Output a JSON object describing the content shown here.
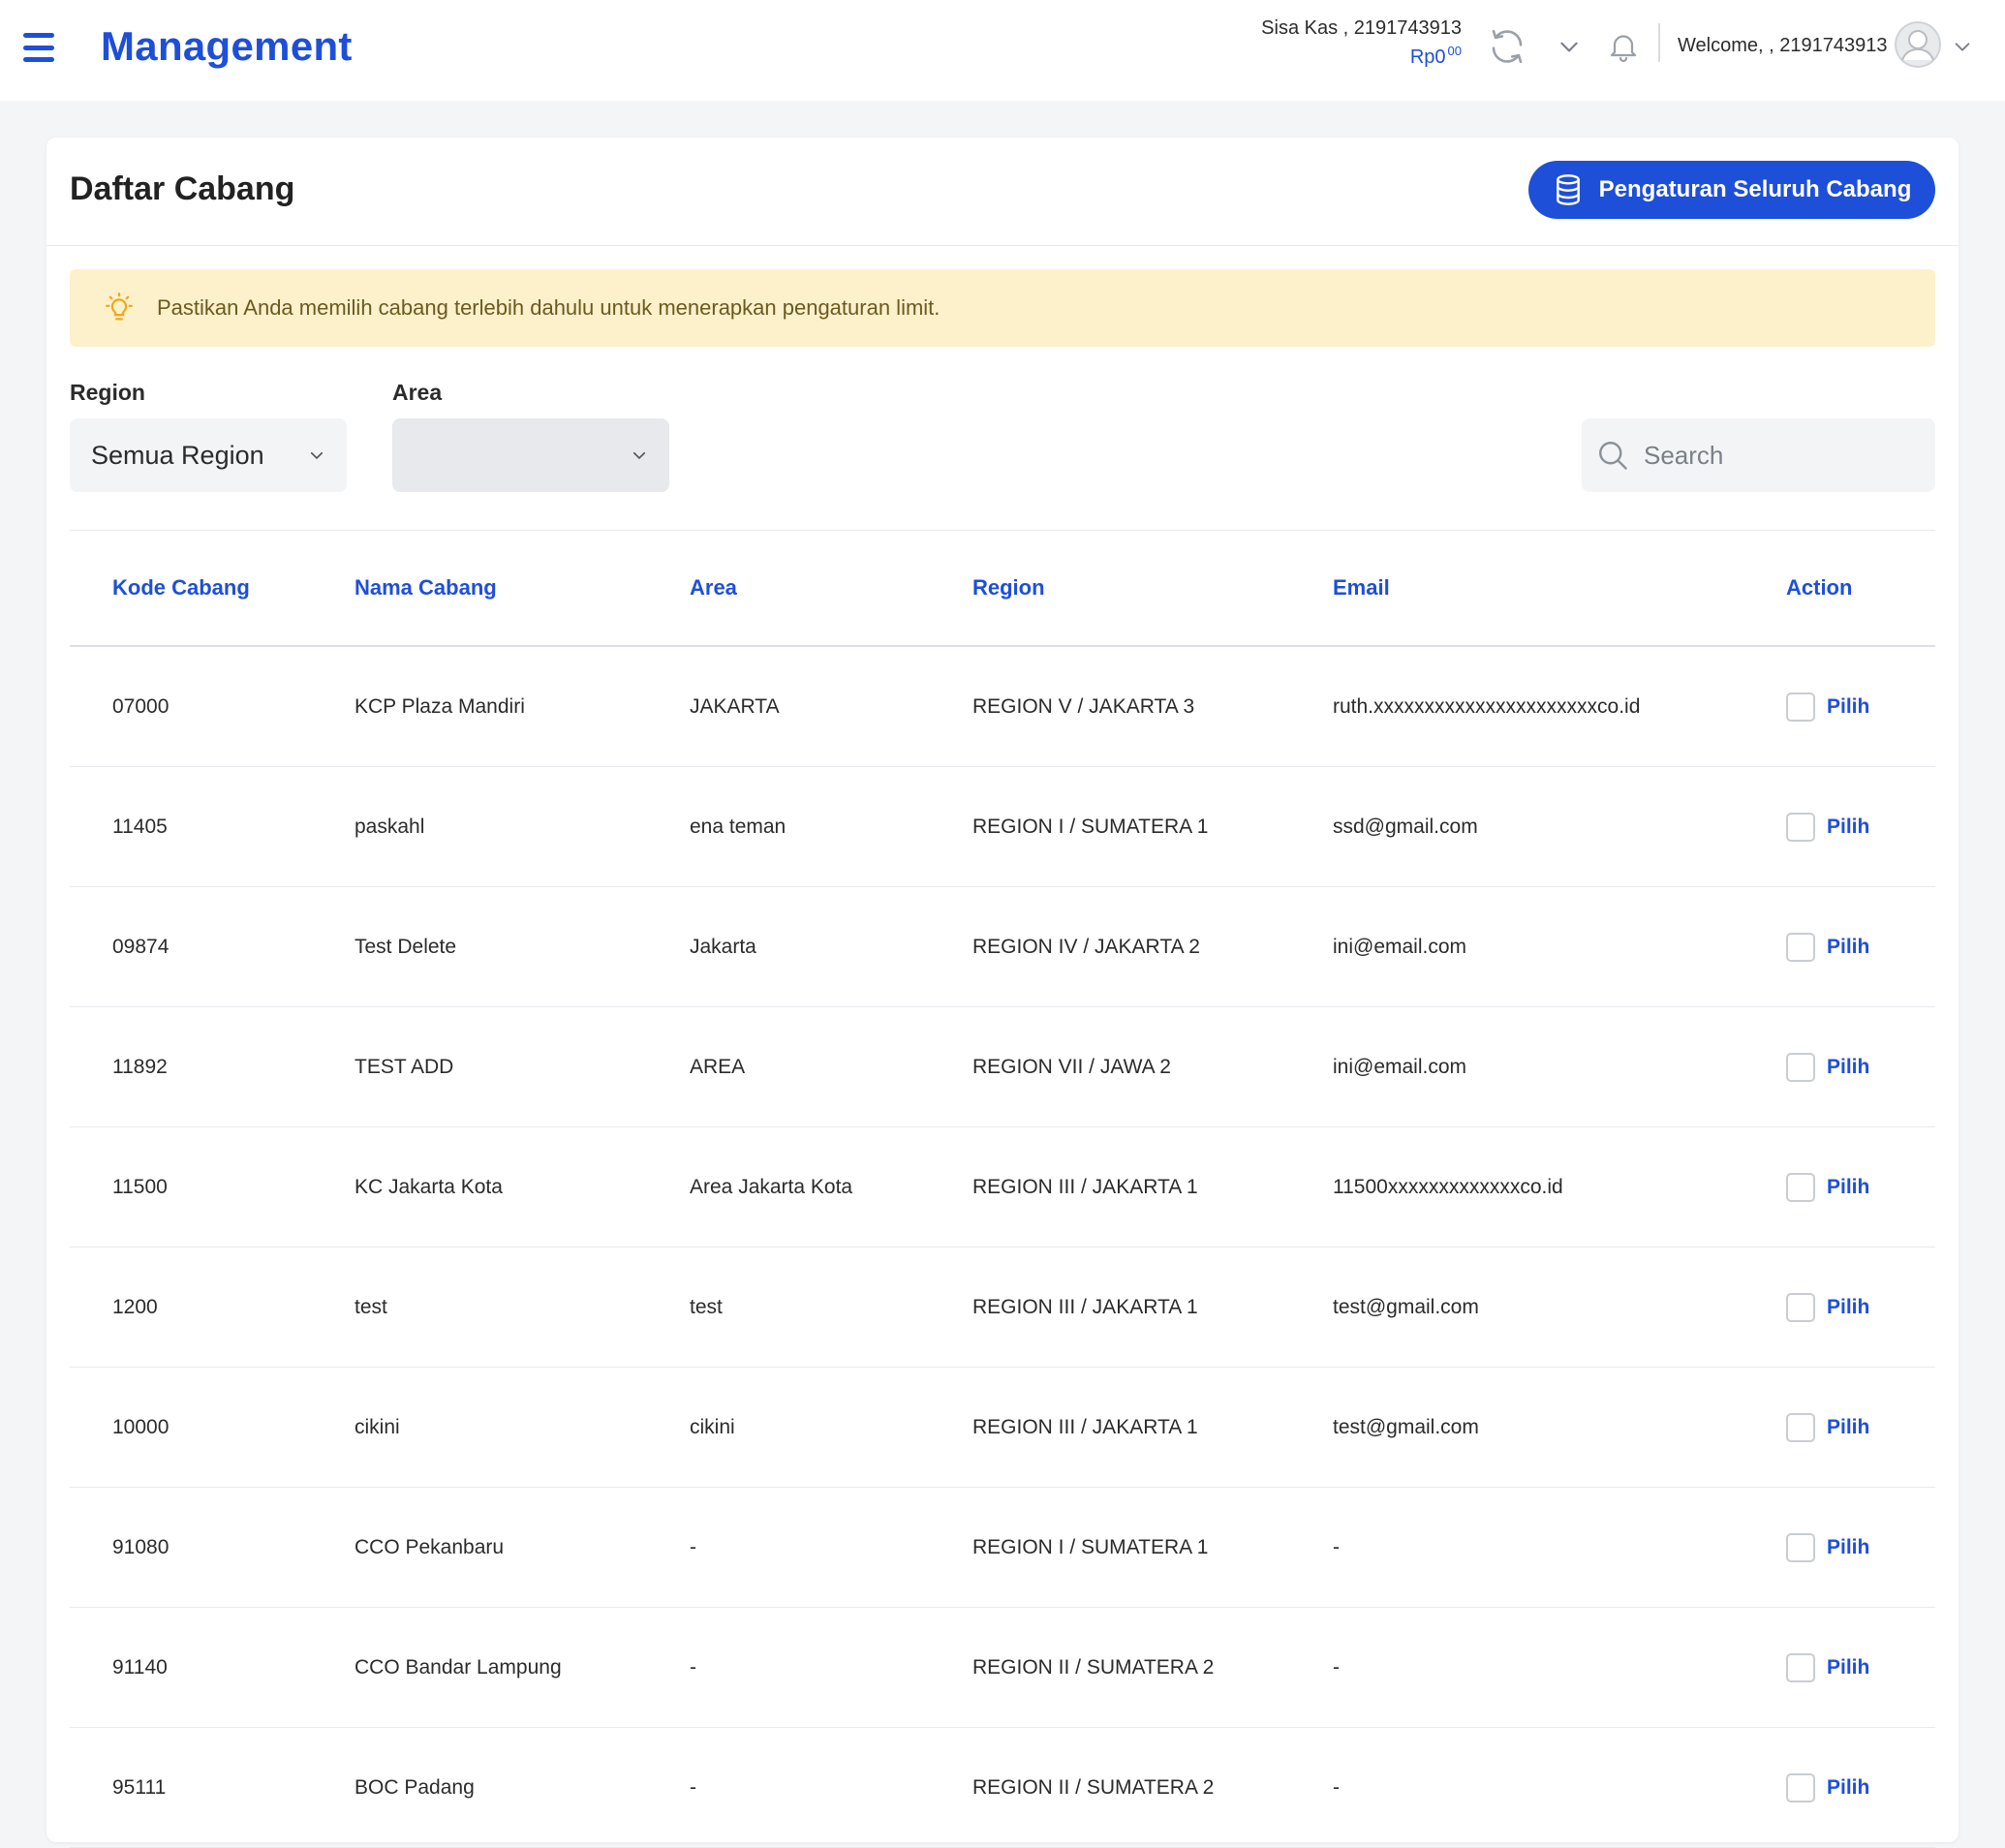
{
  "header": {
    "title": "Management",
    "balance_label": "Sisa Kas , 2191743913",
    "balance_value": "Rp0",
    "balance_decimals": "00",
    "welcome": "Welcome, , 2191743913"
  },
  "page": {
    "title": "Daftar Cabang",
    "settings_button": "Pengaturan Seluruh Cabang",
    "alert": "Pastikan Anda memilih cabang terlebih dahulu untuk menerapkan pengaturan limit."
  },
  "filters": {
    "region_label": "Region",
    "region_value": "Semua Region",
    "area_label": "Area",
    "area_value": "",
    "search_placeholder": "Search"
  },
  "table": {
    "columns": [
      "Kode Cabang",
      "Nama Cabang",
      "Area",
      "Region",
      "Email",
      "Action"
    ],
    "action_label": "Pilih",
    "rows": [
      {
        "code": "07000",
        "name": "KCP Plaza Mandiri",
        "area": "JAKARTA",
        "region": "REGION V / JAKARTA 3",
        "email": "ruth.xxxxxxxxxxxxxxxxxxxxxxco.id"
      },
      {
        "code": "11405",
        "name": "paskahl",
        "area": "ena teman",
        "region": "REGION I / SUMATERA 1",
        "email": "ssd@gmail.com"
      },
      {
        "code": "09874",
        "name": "Test Delete",
        "area": "Jakarta",
        "region": "REGION IV / JAKARTA 2",
        "email": "ini@email.com"
      },
      {
        "code": "11892",
        "name": "TEST ADD",
        "area": "AREA",
        "region": "REGION VII / JAWA 2",
        "email": "ini@email.com"
      },
      {
        "code": "11500",
        "name": "KC Jakarta Kota",
        "area": "Area Jakarta Kota",
        "region": "REGION III / JAKARTA 1",
        "email": "11500xxxxxxxxxxxxxco.id"
      },
      {
        "code": "1200",
        "name": "test",
        "area": "test",
        "region": "REGION III / JAKARTA 1",
        "email": "test@gmail.com"
      },
      {
        "code": "10000",
        "name": "cikini",
        "area": "cikini",
        "region": "REGION III / JAKARTA 1",
        "email": "test@gmail.com"
      },
      {
        "code": "91080",
        "name": "CCO Pekanbaru",
        "area": "-",
        "region": "REGION I / SUMATERA 1",
        "email": "-"
      },
      {
        "code": "91140",
        "name": "CCO Bandar Lampung",
        "area": "-",
        "region": "REGION II / SUMATERA 2",
        "email": "-"
      },
      {
        "code": "95111",
        "name": "BOC Padang",
        "area": "-",
        "region": "REGION II / SUMATERA 2",
        "email": "-"
      }
    ]
  },
  "colors": {
    "primary": "#1e4fd8",
    "alert_bg": "#fdf1cc",
    "alert_text": "#6b5a1f",
    "page_bg": "#f4f5f7"
  },
  "icons": {
    "menu": "hamburger-icon",
    "refresh": "refresh-icon",
    "expand": "chevron-down-icon",
    "notifications": "bell-icon",
    "avatar": "user-avatar-icon",
    "settings": "database-icon",
    "alert": "lightbulb-icon",
    "search": "search-icon"
  }
}
